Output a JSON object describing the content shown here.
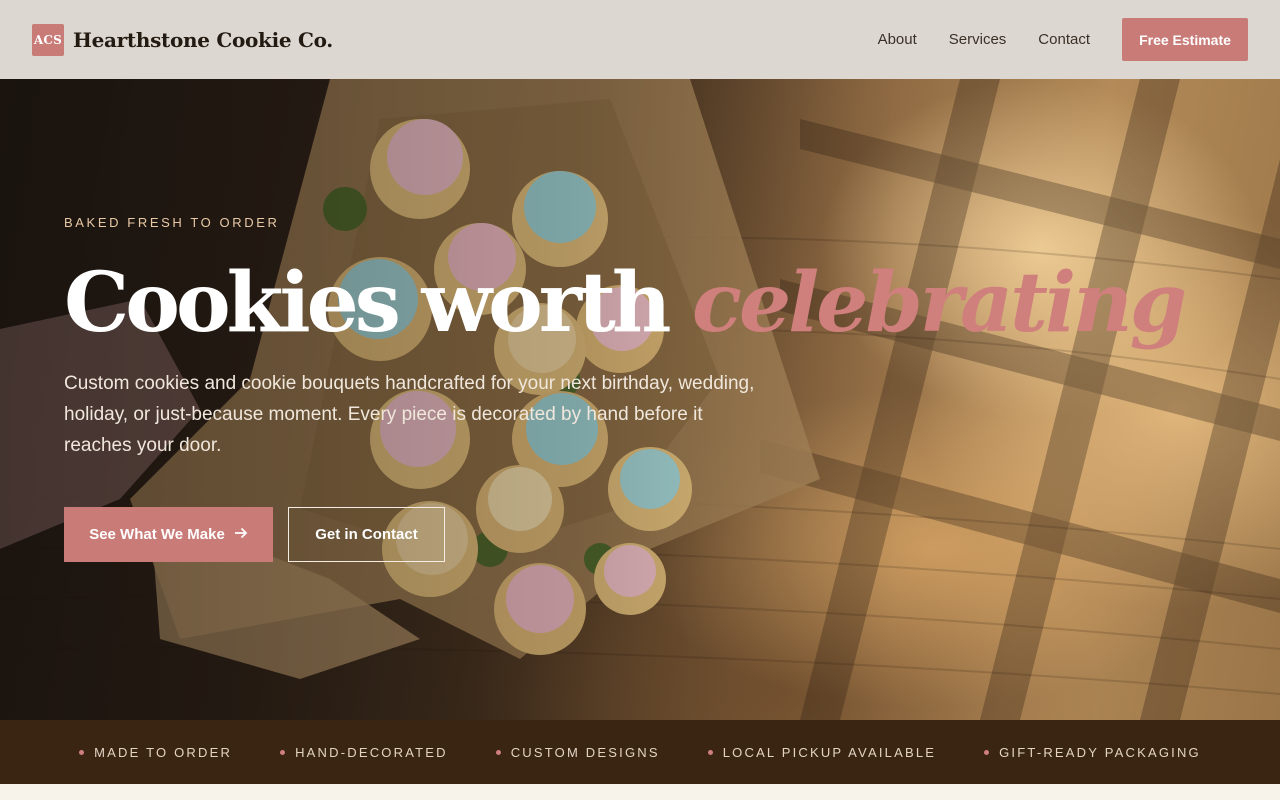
{
  "header": {
    "logo_text": "ACS",
    "brand_name": "Hearthstone Cookie Co.",
    "nav": [
      {
        "label": "About"
      },
      {
        "label": "Services"
      },
      {
        "label": "Contact"
      }
    ],
    "cta_label": "Free Estimate"
  },
  "hero": {
    "eyebrow": "BAKED FRESH TO ORDER",
    "headline_main": "Cookies worth",
    "headline_accent": "celebrating",
    "lead": "Custom cookies and cookie bouquets handcrafted for your next birthday, wedding, holiday, or just-because moment. Every piece is decorated by hand before it reaches your door.",
    "primary_button": "See What We Make",
    "primary_button_icon": "arrow-right-icon",
    "secondary_button": "Get in Contact",
    "image_subject": "cookie-bouquet"
  },
  "features": [
    {
      "label": "MADE TO ORDER"
    },
    {
      "label": "HAND-DECORATED"
    },
    {
      "label": "CUSTOM DESIGNS"
    },
    {
      "label": "LOCAL PICKUP AVAILABLE"
    },
    {
      "label": "GIFT-READY PACKAGING"
    }
  ],
  "colors": {
    "accent": "#c97b78",
    "header_bg": "#dcd8d1",
    "strip_bg": "#3a2513",
    "page_bg": "#f8f3ea"
  }
}
